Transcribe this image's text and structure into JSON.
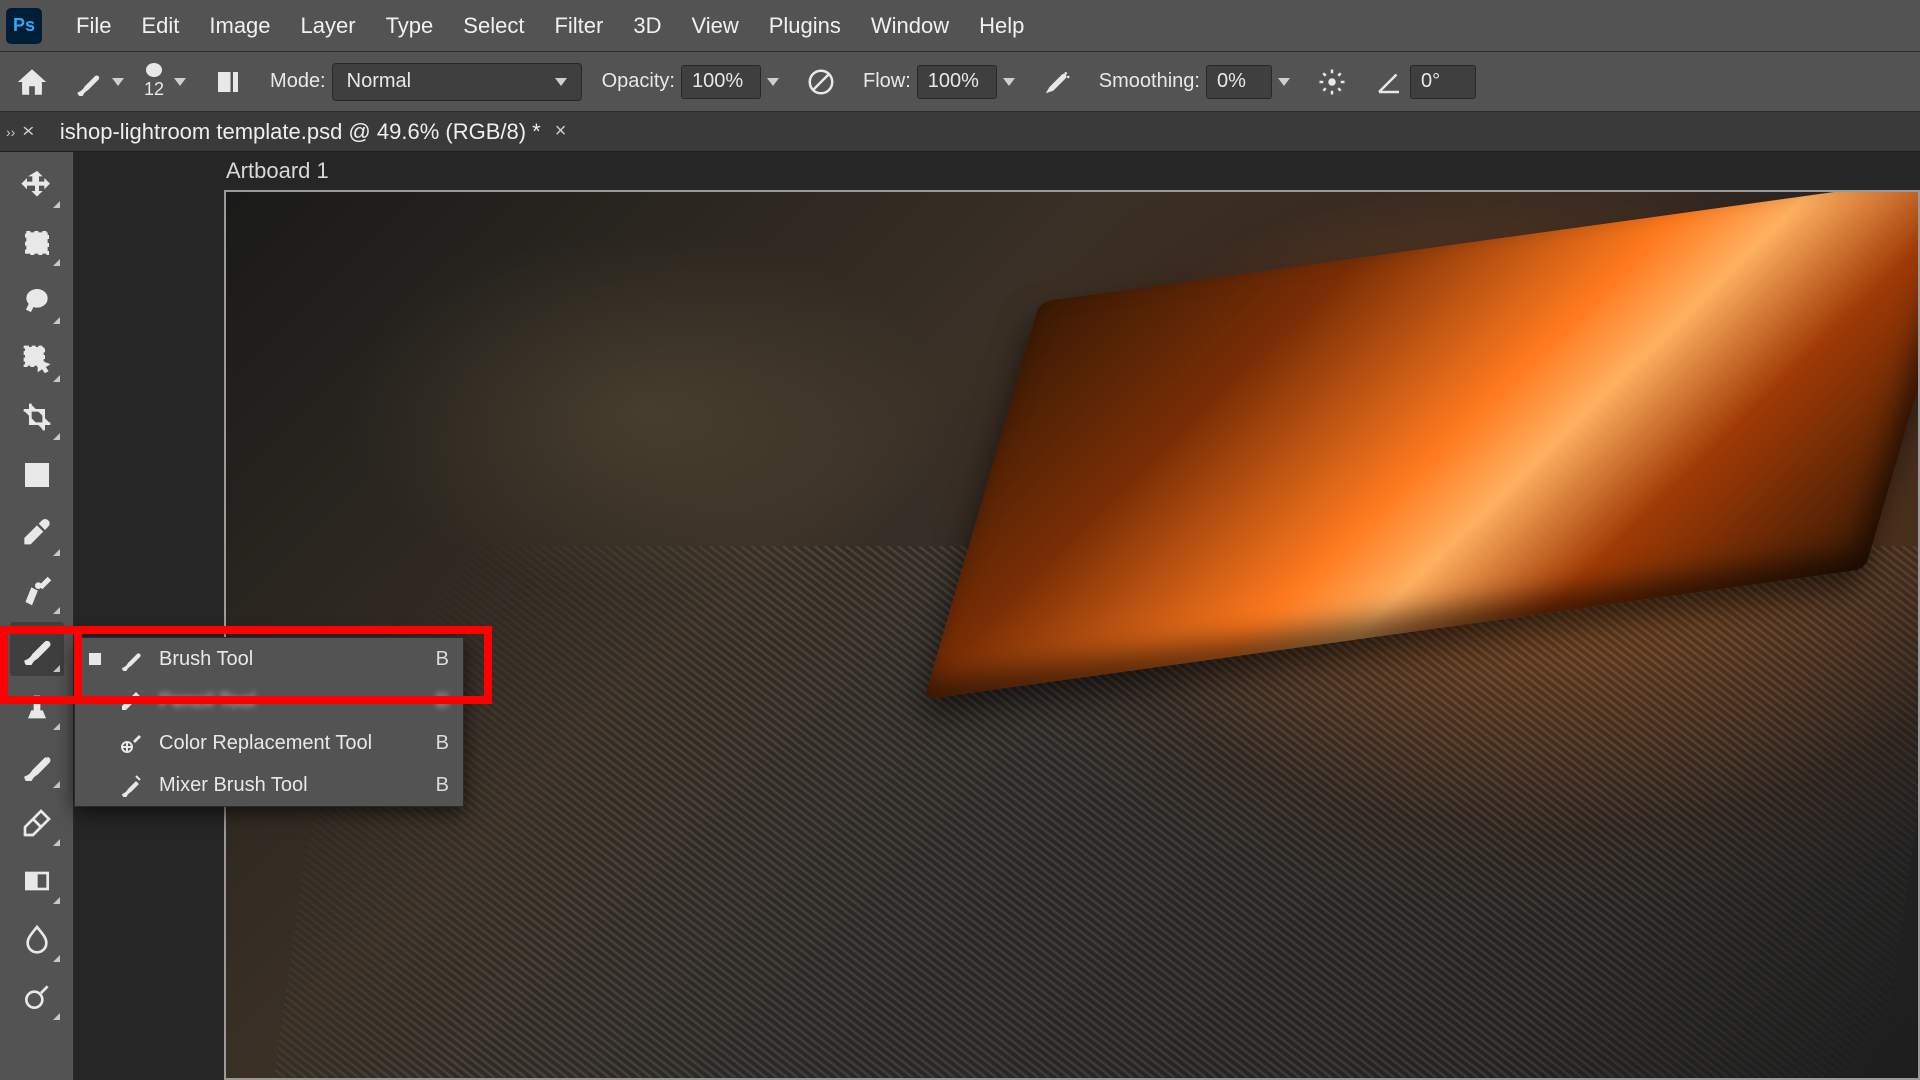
{
  "menubar": {
    "items": [
      "File",
      "Edit",
      "Image",
      "Layer",
      "Type",
      "Select",
      "Filter",
      "3D",
      "View",
      "Plugins",
      "Window",
      "Help"
    ]
  },
  "options": {
    "brush_size": "12",
    "mode_label": "Mode:",
    "mode_value": "Normal",
    "opacity_label": "Opacity:",
    "opacity_value": "100%",
    "flow_label": "Flow:",
    "flow_value": "100%",
    "smoothing_label": "Smoothing:",
    "smoothing_value": "0%",
    "angle_value": "0°"
  },
  "document": {
    "tab_title": "ishop-lightroom template.psd @ 49.6% (RGB/8) *",
    "artboard_label": "Artboard 1"
  },
  "tools": {
    "list": [
      "move-tool",
      "rect-marquee-tool",
      "lasso-tool",
      "object-select-tool",
      "crop-tool",
      "frame-tool",
      "eyedropper-tool",
      "healing-brush-tool",
      "brush-tool",
      "clone-stamp-tool",
      "history-brush-tool",
      "eraser-tool",
      "gradient-tool",
      "blur-tool",
      "dodge-tool"
    ]
  },
  "flyout": {
    "items": [
      {
        "label": "Brush Tool",
        "key": "B",
        "active": true,
        "icon": "brush-icon"
      },
      {
        "label": "Pencil Tool",
        "key": "B",
        "active": false,
        "icon": "pencil-icon",
        "obscured": true
      },
      {
        "label": "Color Replacement Tool",
        "key": "B",
        "active": false,
        "icon": "color-replace-icon"
      },
      {
        "label": "Mixer Brush Tool",
        "key": "B",
        "active": false,
        "icon": "mixer-brush-icon"
      }
    ]
  }
}
